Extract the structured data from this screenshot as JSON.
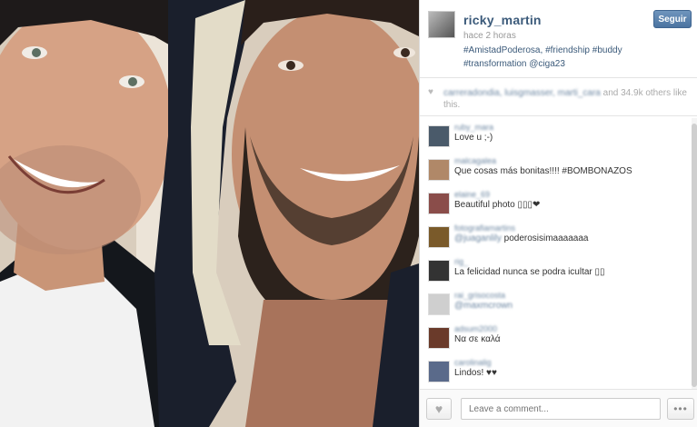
{
  "post": {
    "username": "ricky_martin",
    "follow_label": "Seguir",
    "time": "hace 2 horas",
    "caption_tags": [
      "#AmistadPoderosa,",
      "#friendship",
      "#buddy",
      "#transformation"
    ],
    "caption_mention": "@ciga23"
  },
  "likes": {
    "users_blurred": "carreradondia, luisgmasser, marti_cara",
    "count_text": "and 34.9k others like this."
  },
  "comments": [
    {
      "user": "ruby_mara",
      "text": "Love u ;-)",
      "avatar_color": "#4a5a6a"
    },
    {
      "user": "malcagalea",
      "text": "Que cosas más bonitas!!!! #BOMBONAZOS",
      "avatar_color": "#b08868"
    },
    {
      "user": "elaine_69",
      "text": "Beautiful photo ▯▯▯❤",
      "avatar_color": "#8a4d4a"
    },
    {
      "user": "fotografiamartins",
      "text_mention": "@juaganlily",
      "text": " poderosisimaaaaaaa",
      "avatar_color": "#7a5a2a"
    },
    {
      "user": "rig_",
      "text": "La felicidad nunca se podra icultar ▯▯",
      "avatar_color": "#333333"
    },
    {
      "user": "rai_grisocosta",
      "text_mention": "@maxmcrown",
      "text": "",
      "avatar_color": "#cfcfcf"
    },
    {
      "user": "adsum2000",
      "text": "Να σε καλά",
      "avatar_color": "#6a3a2a"
    },
    {
      "user": "carolinalig",
      "text": "Lindos! ♥♥",
      "avatar_color": "#5a6a8a"
    }
  ],
  "footer": {
    "comment_placeholder": "Leave a comment...",
    "more_label": "•••"
  },
  "icons": {
    "like": "heart-icon",
    "likes_indicator": "heart-icon",
    "more": "ellipsis-icon"
  }
}
